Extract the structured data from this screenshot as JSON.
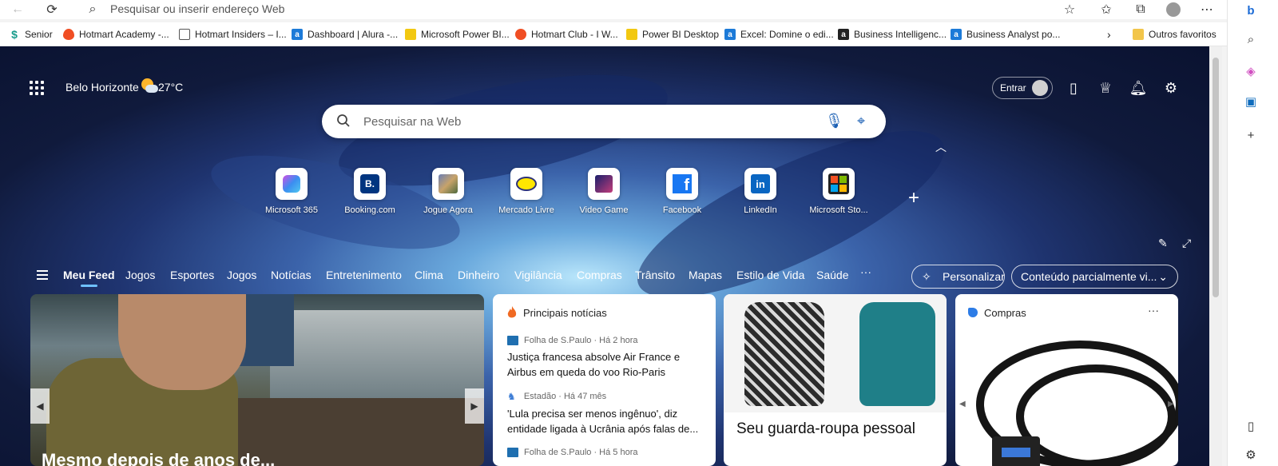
{
  "browser": {
    "address_placeholder": "Pesquisar ou inserir endereço Web",
    "bookmarks": [
      {
        "label": "Senior",
        "icon": "senior-icon",
        "color": "#1a9c8c"
      },
      {
        "label": "Hotmart Academy -...",
        "icon": "hotmart-icon",
        "color": "#f04e23"
      },
      {
        "label": "Hotmart Insiders – I...",
        "icon": "page-icon",
        "color": "#ffffff"
      },
      {
        "label": "Dashboard | Alura -...",
        "icon": "alura-icon",
        "color": "#1c7ad8"
      },
      {
        "label": "Microsoft Power BI...",
        "icon": "powerbi-icon",
        "color": "#f2c811"
      },
      {
        "label": "Hotmart Club - I W...",
        "icon": "hotmart-icon",
        "color": "#f04e23"
      },
      {
        "label": "Power BI Desktop",
        "icon": "powerbi-icon",
        "color": "#f2c811"
      },
      {
        "label": "Excel: Domine o edi...",
        "icon": "alura-icon",
        "color": "#1c7ad8"
      },
      {
        "label": "Business Intelligenc...",
        "icon": "alura-dark-icon",
        "color": "#222222"
      },
      {
        "label": "Business Analyst po...",
        "icon": "alura-icon",
        "color": "#1c7ad8"
      }
    ],
    "other_favorites": "Outros favoritos"
  },
  "ntp": {
    "location": "Belo Horizonte",
    "temperature": "27°C",
    "signin_label": "Entrar",
    "search_placeholder": "Pesquisar na Web",
    "tiles": [
      {
        "label": "Microsoft 365",
        "icon": "m365-icon"
      },
      {
        "label": "Booking.com",
        "icon": "booking-icon",
        "glyph": "B."
      },
      {
        "label": "Jogue Agora",
        "icon": "game-icon"
      },
      {
        "label": "Mercado Livre",
        "icon": "mercadolivre-icon"
      },
      {
        "label": "Video Game",
        "icon": "videogame-icon"
      },
      {
        "label": "Facebook",
        "icon": "facebook-icon",
        "glyph": "f"
      },
      {
        "label": "LinkedIn",
        "icon": "linkedin-icon",
        "glyph": "in"
      },
      {
        "label": "Microsoft Sto...",
        "icon": "msstore-icon"
      }
    ],
    "nav": [
      "Meu Feed",
      "Jogos",
      "Esportes",
      "Jogos",
      "Notícias",
      "Entretenimento",
      "Clima",
      "Dinheiro",
      "Vigilância",
      "Compras",
      "Trânsito",
      "Mapas",
      "Estilo de Vida",
      "Saúde"
    ],
    "more_nav": "···",
    "personalize_label": "Personalizar",
    "content_label": "Conteúdo parcialmente vi..."
  },
  "cards": {
    "hero_caption": "Mesmo depois de anos de... ",
    "news_header": "Principais notícias",
    "news": [
      {
        "source": "Folha de S.Paulo · Há 2 hora",
        "title": "Justiça francesa absolve Air France e Airbus em queda do voo Rio-Paris"
      },
      {
        "source": "Estadão · Há 47 mês",
        "title": "'Lula precisa ser menos ingênuo', diz entidade ligada à Ucrânia após falas de..."
      },
      {
        "source": "Folha de S.Paulo · Há 5 hora",
        "title": ""
      }
    ],
    "fashion_title": "Seu guarda-roupa pessoal",
    "shop_header": "Compras",
    "shop_more": "···"
  },
  "colors": {
    "accent": "#1a5fb4",
    "nav_underline": "#6fc1ff"
  }
}
